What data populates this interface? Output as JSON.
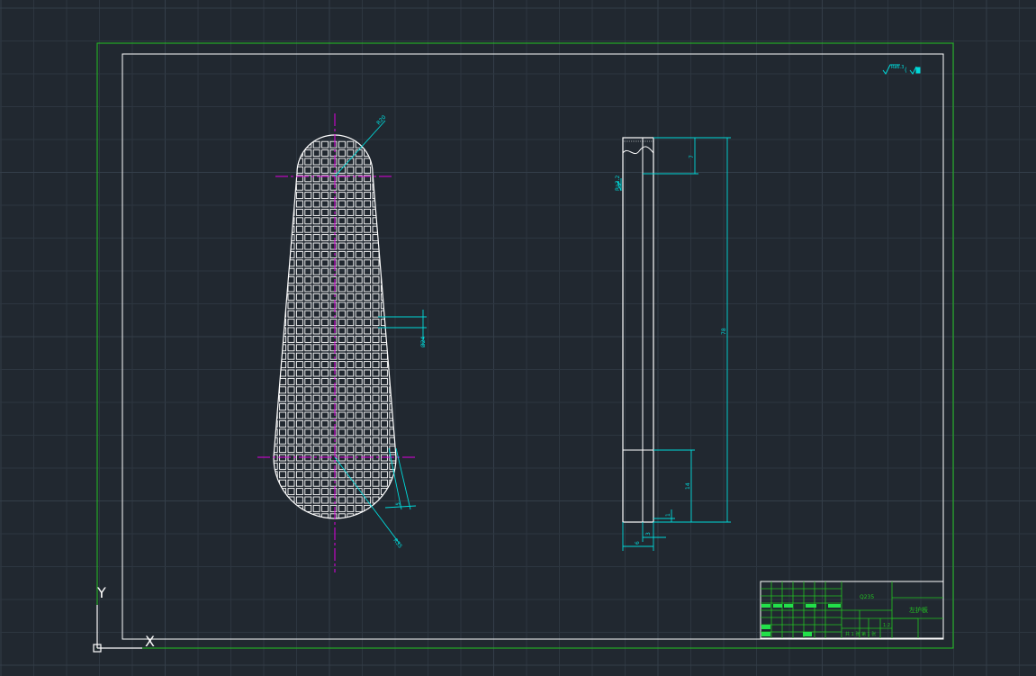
{
  "view": {
    "background": "#212830",
    "grid_color": "#2d3640",
    "grid_major_color": "#343e49"
  },
  "colors": {
    "paper_border": "#22c322",
    "frame": "#ffffff",
    "geometry": "#ffffff",
    "dimension": "#00d9d9",
    "centerline": "#e000e0",
    "title_block_line": "#22c322",
    "title_fill": "#22e04a",
    "ucs": "#ffffff"
  },
  "ucs": {
    "x_label": "X",
    "y_label": "Y"
  },
  "drawing": {
    "front_view": {
      "radius_top_label": "R20",
      "radius_bottom_label": "R35",
      "width_dim_label": "Ø24",
      "grid_pitch_label": "5"
    },
    "side_view": {
      "total_length_label": "78",
      "top_dim_label": "7",
      "bottom_dim_label": "14",
      "thickness_label": "3",
      "width_label": "6",
      "small_label": "1",
      "surface_roughness_label": "Ra3.2"
    },
    "roughness_note": "Ra6.3"
  },
  "title_block": {
    "material": "Q235",
    "part_name": "左护板",
    "scale_label": "1:2",
    "sheet_text": "共 1 张  第 1 张"
  }
}
